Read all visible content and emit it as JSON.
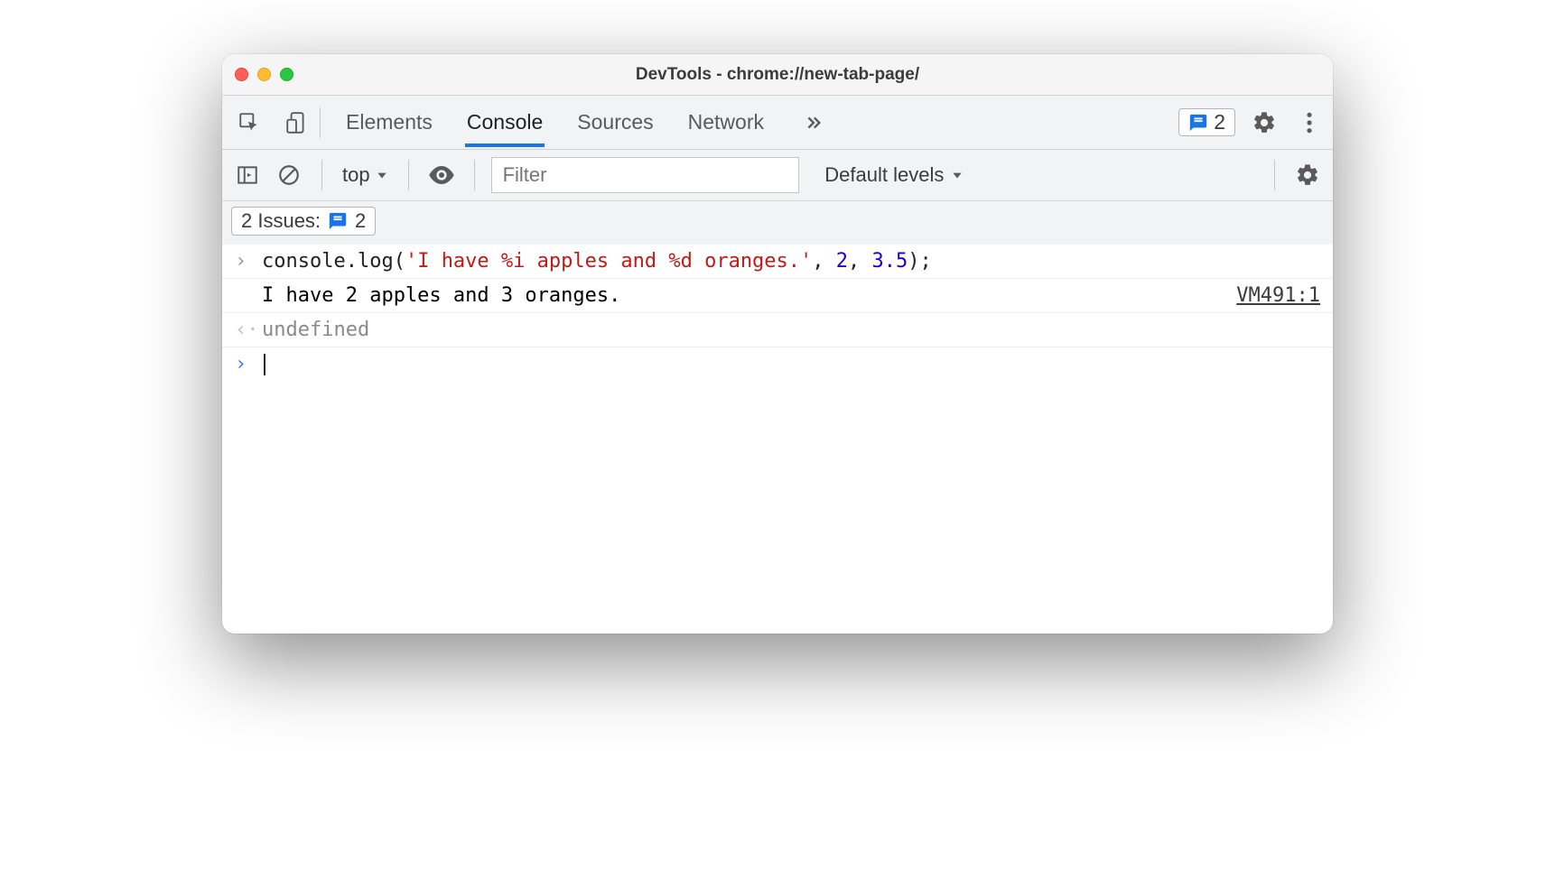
{
  "title": "DevTools - chrome://new-tab-page/",
  "tabs": {
    "elements": "Elements",
    "console": "Console",
    "sources": "Sources",
    "network": "Network"
  },
  "issues_count_top": "2",
  "toolbar": {
    "context": "top",
    "filter_placeholder": "Filter",
    "levels": "Default levels"
  },
  "issues_bar": {
    "label": "2 Issues:",
    "count": "2"
  },
  "console": {
    "input_method": "console.log",
    "input_paren_open": "(",
    "input_string": "'I have %i apples and %d oranges.'",
    "input_comma1": ", ",
    "input_arg1": "2",
    "input_comma2": ", ",
    "input_arg2": "3.5",
    "input_paren_close": ");",
    "output": "I have 2 apples and 3 oranges.",
    "output_source": "VM491:1",
    "return_value": "undefined"
  }
}
